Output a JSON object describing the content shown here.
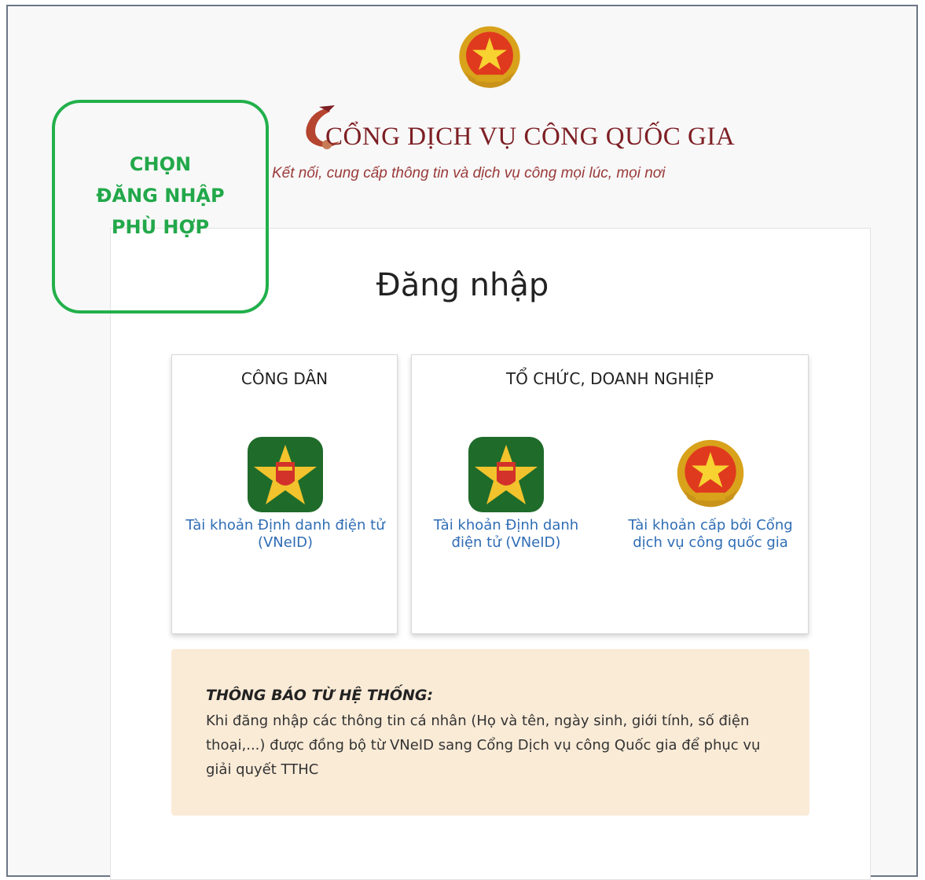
{
  "header": {
    "emblem_icon": "national-emblem-icon",
    "title": "CỔNG DỊCH VỤ CÔNG QUỐC GIA",
    "slogan": "Kết nối, cung cấp thông tin và dịch vụ công mọi lúc, mọi nơi"
  },
  "login": {
    "heading": "Đăng nhập",
    "citizen": {
      "title": "CÔNG DÂN",
      "options": [
        {
          "label": "Tài khoản Định danh điện tử (VNeID)",
          "icon": "vneid-icon"
        }
      ]
    },
    "organization": {
      "title": "TỔ CHỨC, DOANH NGHIỆP",
      "options": [
        {
          "label": "Tài khoản Định danh điện tử (VNeID)",
          "icon": "vneid-icon"
        },
        {
          "label": "Tài khoản cấp bởi Cổng dịch vụ công quốc gia",
          "icon": "national-emblem-icon"
        }
      ]
    }
  },
  "notice": {
    "title": "THÔNG BÁO TỪ HỆ THỐNG:",
    "body": "Khi đăng nhập các thông tin cá nhân (Họ và tên, ngày sinh, giới tính, số điện thoại,...) được đồng bộ từ VNeID sang Cổng Dịch vụ công Quốc gia để phục vụ giải quyết TTHC"
  },
  "annotation": {
    "lines": [
      "CHỌN",
      "ĐĂNG NHẬP",
      "PHÙ HỢP"
    ]
  },
  "colors": {
    "title": "#7d1f24",
    "link": "#2f6db5",
    "notice_bg": "#faebd7",
    "annotation": "#22b04b"
  }
}
